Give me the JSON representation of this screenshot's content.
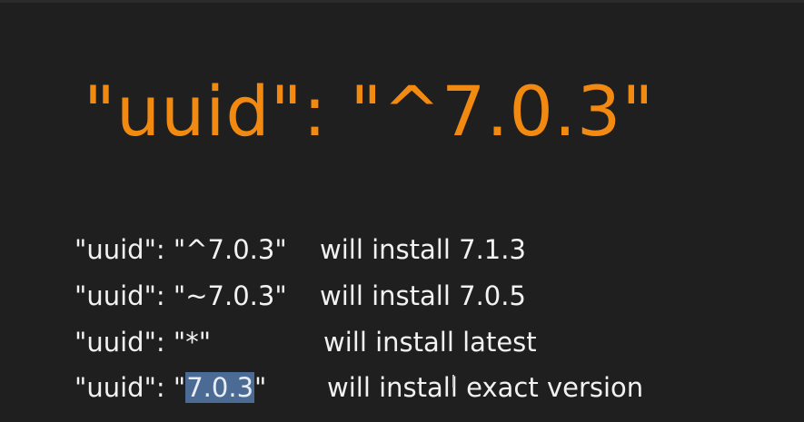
{
  "headline": "\"uuid\": \"^7.0.3\"",
  "rows": [
    {
      "code": "\"uuid\": \"^7.0.3\"",
      "desc": "will install 7.1.3"
    },
    {
      "code": "\"uuid\": \"~7.0.3\"",
      "desc": "will install  7.0.5"
    },
    {
      "code": "\"uuid\": \"*\"",
      "desc": "will install latest"
    },
    {
      "code_prefix": "\"uuid\": \"",
      "code_selected": "7.0.3",
      "code_suffix": "\"",
      "desc_prefix": "will install",
      "desc_suffix": " exact version"
    }
  ],
  "colors": {
    "background": "#1f1f1f",
    "headline": "#f28a12",
    "text": "#f2f2f2",
    "selection": "#4c6b94"
  }
}
